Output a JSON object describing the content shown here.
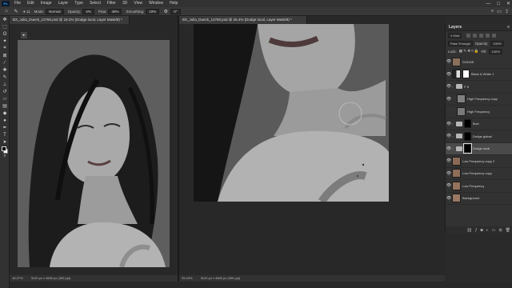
{
  "menubar": {
    "logo": "Ps",
    "items": [
      "File",
      "Edit",
      "Image",
      "Layer",
      "Type",
      "Select",
      "Filter",
      "3D",
      "View",
      "Window",
      "Help"
    ],
    "minimize": "—",
    "maximize": "□",
    "close": "✕"
  },
  "options": {
    "brush_size": "11",
    "mode_label": "Mode:",
    "mode_value": "Normal",
    "opacity_label": "Opacity:",
    "opacity_value": "4%",
    "flow_label": "Flow:",
    "flow_value": "40%",
    "smoothing_label": "Smoothing:",
    "smoothing_value": "10%",
    "angle_value": "0°"
  },
  "doc_left": {
    "tab": "BX_Julia_Dueck_12760.psd @ 18.2% (Dodge local, Layer Mask/8) *",
    "zoom": "18.27%",
    "size": "3120 px x 4680 px (300 ppi)"
  },
  "doc_right": {
    "tab": "BX_Julia_Dueck_12760.psd @ 25.4% (Dodge local, Layer Mask/8) *",
    "zoom": "25.43%",
    "size": "3120 px x 4680 px (300 ppi)"
  },
  "layers_panel": {
    "title": "Layers",
    "filter_kind": "Kind",
    "blend_mode": "Pass Through",
    "opacity_label": "Opacity:",
    "opacity_value": "100%",
    "lock_label": "Lock:",
    "fill_label": "Fill:",
    "fill_value": "100%",
    "layers": [
      {
        "name": "DODGE",
        "type": "thumb"
      },
      {
        "name": "Black & White 1",
        "type": "adjust"
      },
      {
        "name": "F S",
        "type": "group"
      },
      {
        "name": "High Frequency copy",
        "type": "plain"
      },
      {
        "name": "High Frequency",
        "type": "plain"
      },
      {
        "name": "Burn",
        "type": "group"
      },
      {
        "name": "Dodge global",
        "type": "group"
      },
      {
        "name": "Dodge local",
        "type": "group"
      },
      {
        "name": "Low Frequency copy 2",
        "type": "thumb"
      },
      {
        "name": "Low Frequency copy",
        "type": "thumb"
      },
      {
        "name": "Low Frequency",
        "type": "thumb"
      },
      {
        "name": "Background",
        "type": "thumb"
      }
    ]
  },
  "colors": {
    "accent": "#31a8ff",
    "panel_bg": "#323232",
    "canvas_bg": "#282828"
  }
}
